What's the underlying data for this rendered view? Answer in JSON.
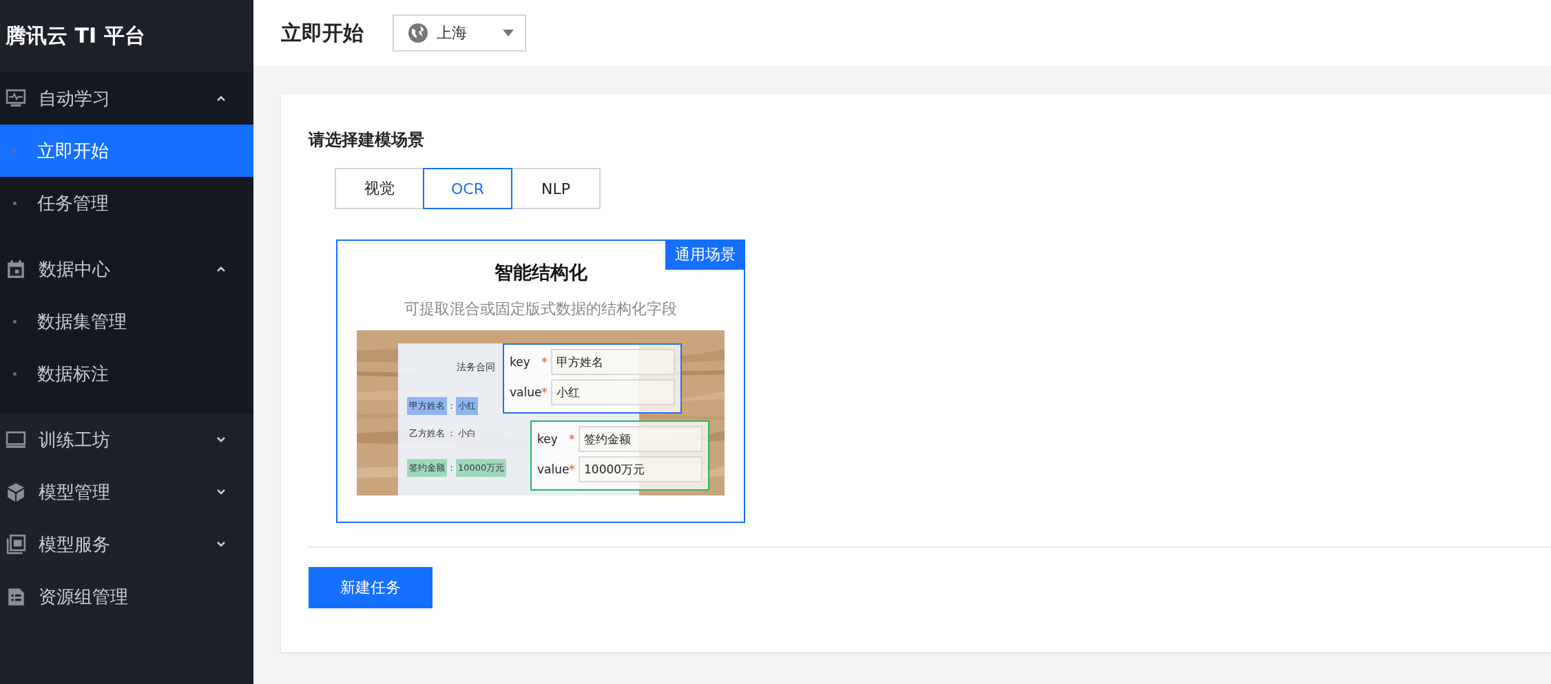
{
  "sidebar": {
    "title": "腾讯云 TI 平台",
    "items": [
      {
        "kind": "group",
        "label": "自动学习",
        "expanded": true,
        "children": [
          {
            "label": "立即开始",
            "selected": true
          },
          {
            "label": "任务管理",
            "selected": false
          }
        ]
      },
      {
        "kind": "group",
        "label": "数据中心",
        "expanded": true,
        "children": [
          {
            "label": "数据集管理",
            "selected": false
          },
          {
            "label": "数据标注",
            "selected": false
          }
        ]
      },
      {
        "kind": "group",
        "label": "训练工坊",
        "expanded": false
      },
      {
        "kind": "group",
        "label": "模型管理",
        "expanded": false
      },
      {
        "kind": "group",
        "label": "模型服务",
        "expanded": false
      },
      {
        "kind": "link",
        "label": "资源组管理"
      }
    ]
  },
  "header": {
    "title": "立即开始",
    "region": "上海"
  },
  "content": {
    "heading": "请选择建模场景",
    "tabs": [
      {
        "label": "视觉",
        "selected": false
      },
      {
        "label": "OCR",
        "selected": true
      },
      {
        "label": "NLP",
        "selected": false
      }
    ],
    "scenario": {
      "title": "智能结构化",
      "tag": "通用场景",
      "description": "可提取混合或固定版式数据的结构化字段",
      "illustration": {
        "doc_title": "法务合同",
        "doc_fields": [
          {
            "label": "甲方姓名",
            "colon": "：",
            "value": "小红",
            "color": "#8fb6f0"
          },
          {
            "label": "乙方姓名",
            "colon": "：",
            "value": "小白"
          },
          {
            "label": "签约金额",
            "colon": "：",
            "value": "10000万元",
            "color": "#9fd9bb"
          }
        ],
        "callouts": [
          {
            "key_label": "key",
            "key_mark": "*",
            "key": "甲方姓名",
            "value_label": "value",
            "value_mark": "*",
            "value": "小红",
            "color": "#2a6fe0"
          },
          {
            "key_label": "key",
            "key_mark": "*",
            "key": "签约金额",
            "value_label": "value",
            "value_mark": "*",
            "value": "10000万元",
            "color": "#2bb56a"
          }
        ]
      }
    },
    "button": "新建任务"
  }
}
